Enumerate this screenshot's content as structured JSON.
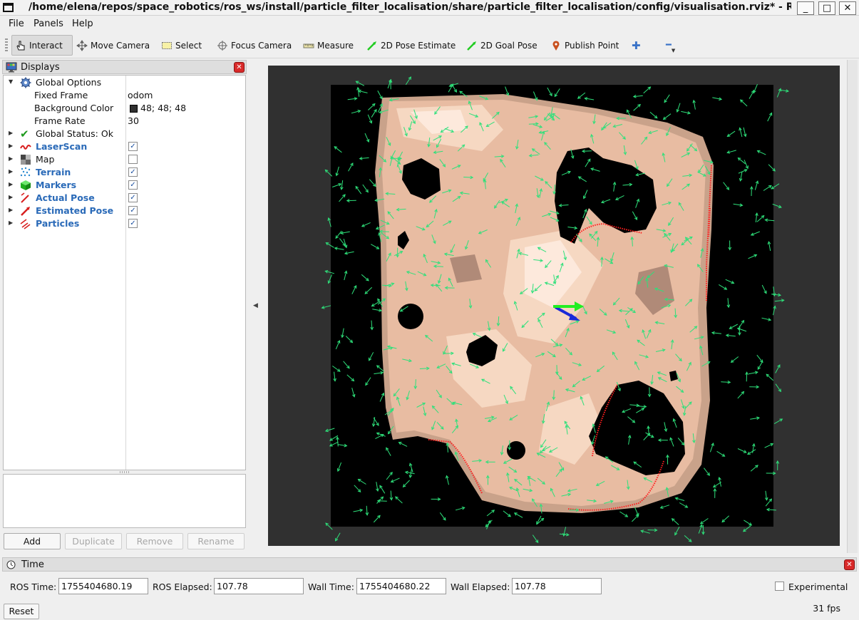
{
  "window": {
    "title": "/home/elena/repos/space_robotics/ros_ws/install/particle_filter_localisation/share/particle_filter_localisation/config/visualisation.rviz* - RViz",
    "minimize_glyph": "_",
    "maximize_glyph": "□",
    "close_glyph": "✕"
  },
  "menu": {
    "file": "File",
    "panels": "Panels",
    "help": "Help"
  },
  "toolbar": {
    "interact": "Interact",
    "move_camera": "Move Camera",
    "select": "Select",
    "focus_camera": "Focus Camera",
    "measure": "Measure",
    "pose_estimate": "2D Pose Estimate",
    "goal_pose": "2D Goal Pose",
    "publish_point": "Publish Point",
    "add_tool_glyph": "✚",
    "remove_tool_glyph": "━"
  },
  "displays": {
    "title": "Displays",
    "global_options": {
      "label": "Global Options",
      "fixed_frame_label": "Fixed Frame",
      "fixed_frame_value": "odom",
      "background_color_label": "Background Color",
      "background_color_value": "48; 48; 48",
      "background_swatch": "#303030",
      "frame_rate_label": "Frame Rate",
      "frame_rate_value": "30"
    },
    "global_status": "Global Status: Ok",
    "items": [
      {
        "label": "LaserScan",
        "checked": true,
        "icon": "laserscan-icon"
      },
      {
        "label": "Map",
        "checked": false,
        "icon": "map-icon"
      },
      {
        "label": "Terrain",
        "checked": true,
        "icon": "pointcloud-icon"
      },
      {
        "label": "Markers",
        "checked": true,
        "icon": "marker-cube-icon"
      },
      {
        "label": "Actual Pose",
        "checked": true,
        "icon": "pose-icon"
      },
      {
        "label": "Estimated Pose",
        "checked": true,
        "icon": "pose-icon"
      },
      {
        "label": "Particles",
        "checked": true,
        "icon": "pose-array-icon"
      }
    ],
    "checkmark": "✓",
    "buttons": {
      "add": "Add",
      "duplicate": "Duplicate",
      "remove": "Remove",
      "rename": "Rename"
    }
  },
  "viewport": {
    "background_color": "#303030",
    "map_unknown_color": "#000000",
    "terrain_colors": [
      "#e8bca2",
      "#f6d8c2",
      "#fde9dc",
      "#c9a28a",
      "#b08a78"
    ],
    "particle_color": "#2ee07a",
    "laser_color": "#ff1e1e",
    "actual_pose_color": "#22ee22",
    "estimated_pose_color": "#1a2ad8"
  },
  "time": {
    "title": "Time",
    "ros_time_label": "ROS Time:",
    "ros_time_value": "1755404680.19",
    "ros_elapsed_label": "ROS Elapsed:",
    "ros_elapsed_value": "107.78",
    "wall_time_label": "Wall Time:",
    "wall_time_value": "1755404680.22",
    "wall_elapsed_label": "Wall Elapsed:",
    "wall_elapsed_value": "107.78",
    "experimental_label": "Experimental",
    "experimental_checked": false,
    "reset": "Reset",
    "fps": "31 fps"
  }
}
